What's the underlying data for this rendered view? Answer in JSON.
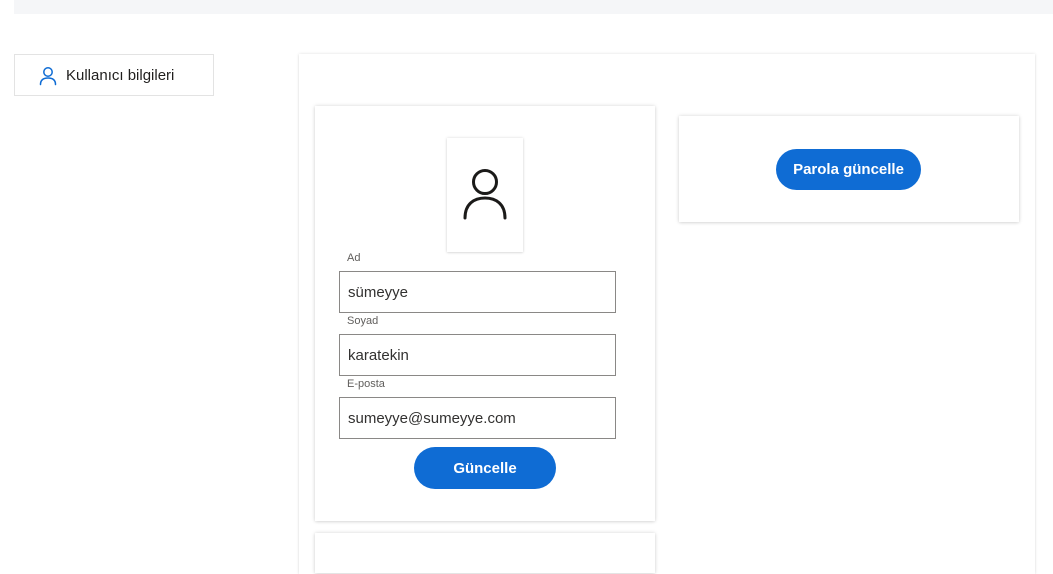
{
  "sidebar": {
    "items": [
      {
        "label": "Kullanıcı bilgileri",
        "icon": "person-icon"
      }
    ]
  },
  "profile": {
    "avatar_icon": "person-icon",
    "fields": {
      "first_name": {
        "label": "Ad",
        "value": "sümeyye"
      },
      "last_name": {
        "label": "Soyad",
        "value": "karatekin"
      },
      "email": {
        "label": "E-posta",
        "value": "sumeyye@sumeyye.com"
      }
    },
    "update_button_label": "Güncelle"
  },
  "password": {
    "update_button_label": "Parola güncelle"
  },
  "colors": {
    "accent": "#0f6cd4",
    "top_bar": "#f5f6f8",
    "input_border": "#8a8886"
  }
}
